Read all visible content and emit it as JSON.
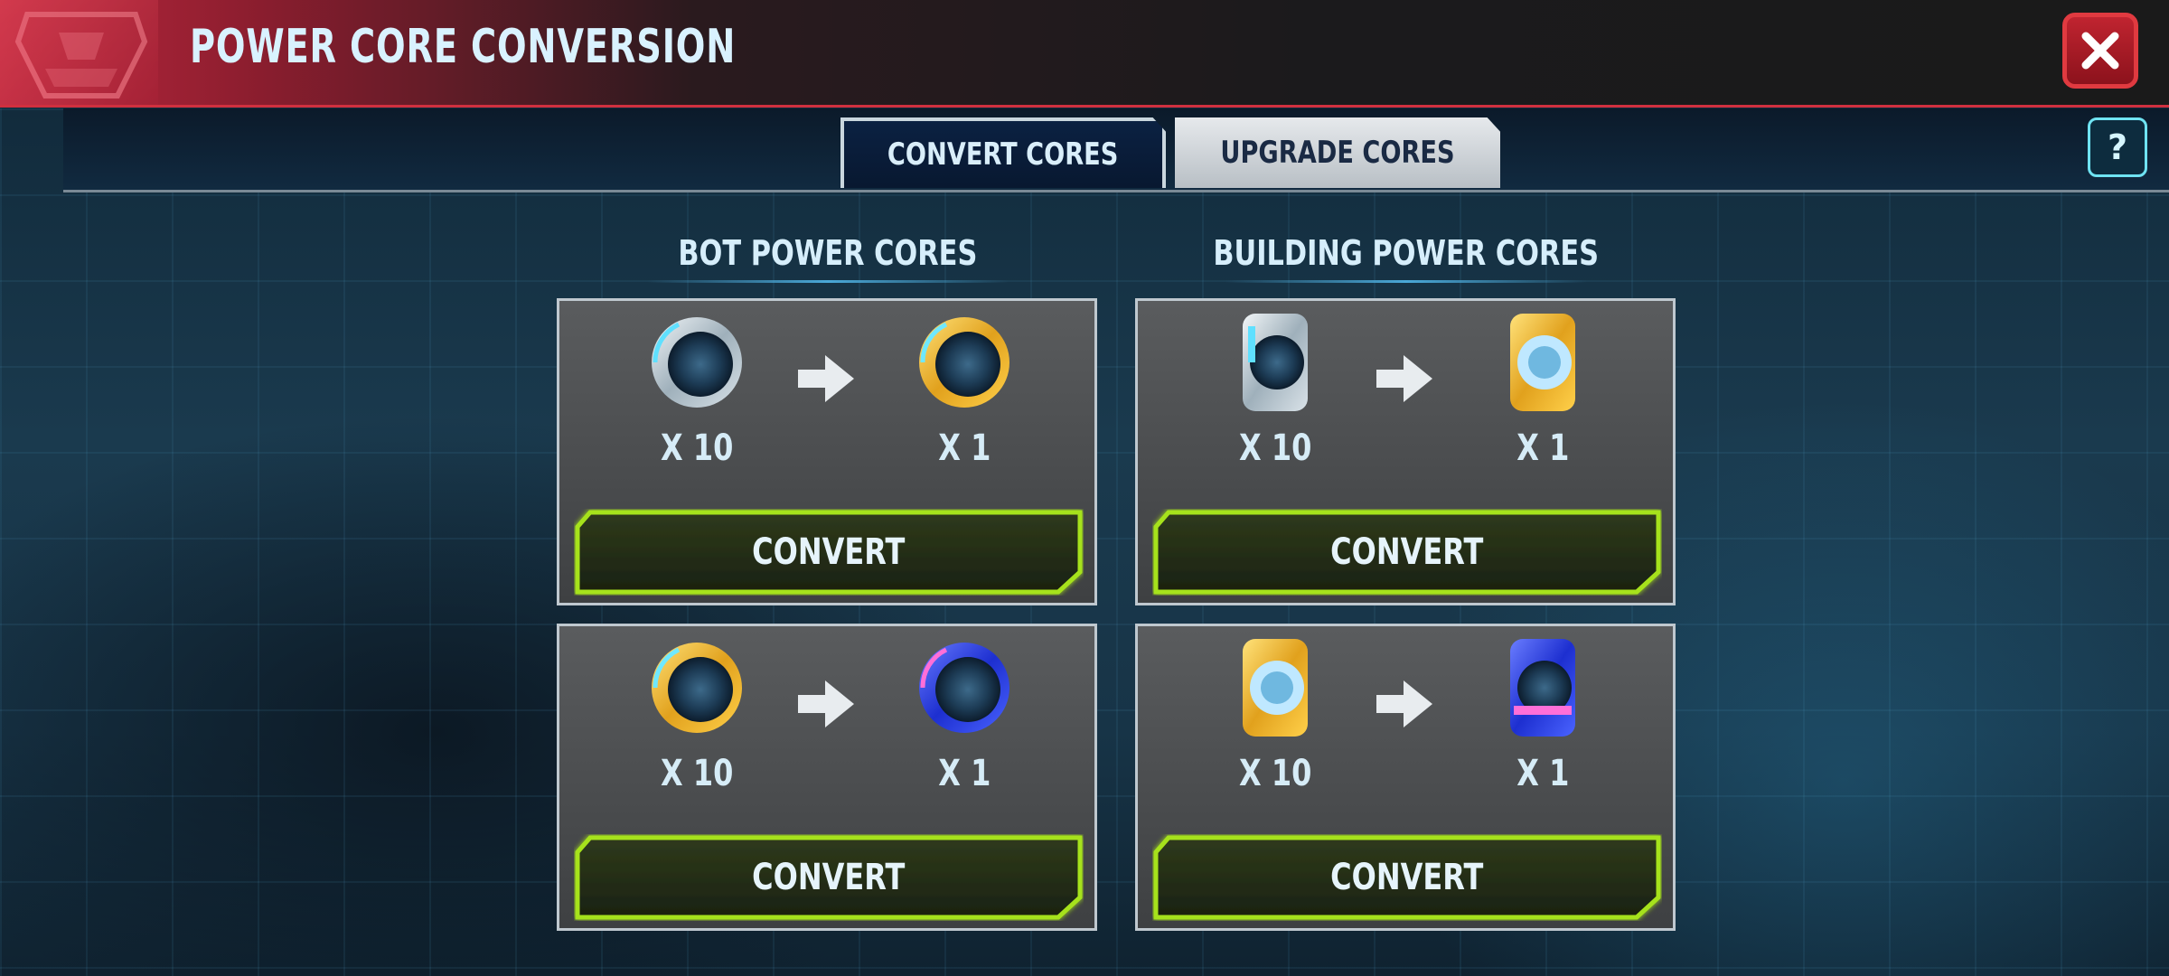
{
  "header": {
    "title": "POWER CORE CONVERSION",
    "close_icon": "close-x-icon",
    "emblem_icon": "faction-emblem-icon"
  },
  "tabs": [
    {
      "label": "CONVERT CORES",
      "active": true
    },
    {
      "label": "UPGRADE CORES",
      "active": false
    }
  ],
  "help": {
    "label": "?"
  },
  "sections": {
    "bot": {
      "title": "BOT POWER CORES"
    },
    "building": {
      "title": "BUILDING POWER CORES"
    }
  },
  "cards": [
    {
      "from_icon": "silver-bot-core-icon",
      "to_icon": "gold-bot-core-icon",
      "from_qty": "X 10",
      "to_qty": "X 1",
      "button": "CONVERT"
    },
    {
      "from_icon": "silver-building-core-icon",
      "to_icon": "gold-building-core-icon",
      "from_qty": "X 10",
      "to_qty": "X 1",
      "button": "CONVERT"
    },
    {
      "from_icon": "gold-bot-core-icon",
      "to_icon": "blue-bot-core-icon",
      "from_qty": "X 10",
      "to_qty": "X 1",
      "button": "CONVERT"
    },
    {
      "from_icon": "gold-building-core-icon",
      "to_icon": "blue-building-core-icon",
      "from_qty": "X 10",
      "to_qty": "X 1",
      "button": "CONVERT"
    }
  ],
  "colors": {
    "header_red": "#c0283e",
    "button_green": "#a6e21a",
    "text_light": "#d6eefb"
  }
}
